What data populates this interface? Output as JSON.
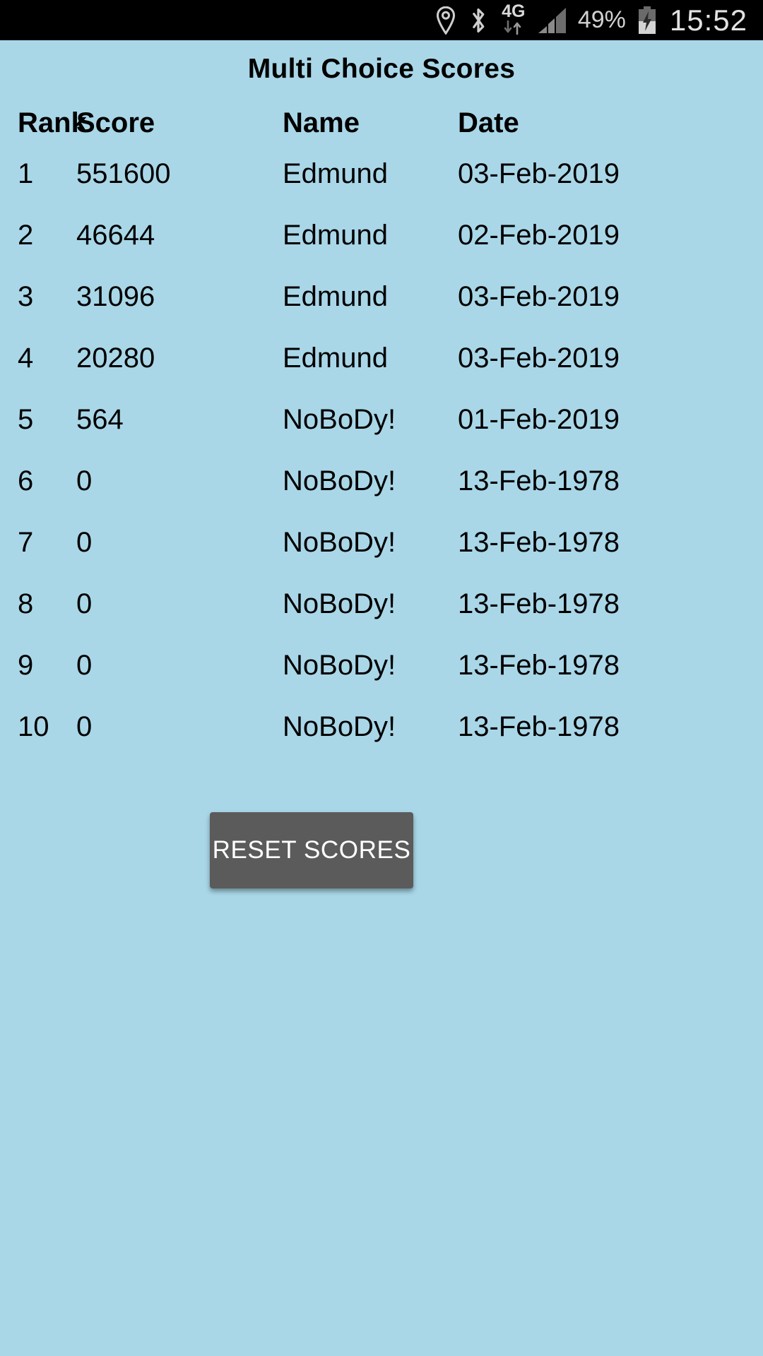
{
  "status_bar": {
    "icons": [
      {
        "name": "location-pin-icon",
        "label": "location"
      },
      {
        "name": "bluetooth-icon",
        "label": "bluetooth"
      },
      {
        "name": "mobile-data-4g-icon",
        "label": "4G"
      },
      {
        "name": "signal-bars-icon",
        "label": "signal"
      }
    ],
    "network_label": "4G",
    "battery_percent": "49%",
    "battery_icon": "battery-charging-icon",
    "clock": "15:52",
    "background_color": "#000000",
    "foreground_color": "#d2d2d2"
  },
  "app": {
    "title": "Multi Choice Scores",
    "background_color": "#a9d7e8",
    "text_color": "#000000"
  },
  "table": {
    "headers": {
      "rank": "Rank",
      "score": "Score",
      "name": "Name",
      "date": "Date"
    },
    "rows": [
      {
        "rank": "1",
        "score": "551600",
        "name": "Edmund",
        "date": "03-Feb-2019"
      },
      {
        "rank": "2",
        "score": "46644",
        "name": "Edmund",
        "date": "02-Feb-2019"
      },
      {
        "rank": "3",
        "score": "31096",
        "name": "Edmund",
        "date": "03-Feb-2019"
      },
      {
        "rank": "4",
        "score": "20280",
        "name": "Edmund",
        "date": "03-Feb-2019"
      },
      {
        "rank": "5",
        "score": "564",
        "name": "NoBoDy!",
        "date": "01-Feb-2019"
      },
      {
        "rank": "6",
        "score": "0",
        "name": "NoBoDy!",
        "date": "13-Feb-1978"
      },
      {
        "rank": "7",
        "score": "0",
        "name": "NoBoDy!",
        "date": "13-Feb-1978"
      },
      {
        "rank": "8",
        "score": "0",
        "name": "NoBoDy!",
        "date": "13-Feb-1978"
      },
      {
        "rank": "9",
        "score": "0",
        "name": "NoBoDy!",
        "date": "13-Feb-1978"
      },
      {
        "rank": "10",
        "score": "0",
        "name": "NoBoDy!",
        "date": "13-Feb-1978"
      }
    ]
  },
  "actions": {
    "reset_label": "RESET SCORES",
    "reset_background_color": "#5b5b5b",
    "reset_text_color": "#ffffff"
  }
}
